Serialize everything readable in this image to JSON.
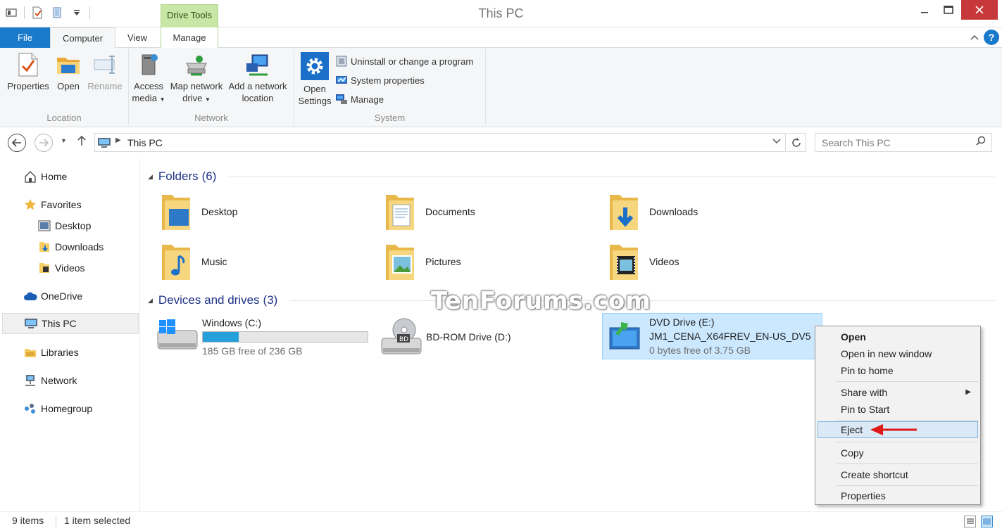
{
  "window": {
    "title": "This PC",
    "context_tab_header": "Drive Tools"
  },
  "tabs": {
    "file": "File",
    "computer": "Computer",
    "view": "View",
    "manage": "Manage"
  },
  "ribbon": {
    "location": {
      "label": "Location",
      "properties": "Properties",
      "open": "Open",
      "rename": "Rename"
    },
    "network": {
      "label": "Network",
      "access_media_1": "Access",
      "access_media_2": "media",
      "map_drive_1": "Map network",
      "map_drive_2": "drive",
      "add_location_1": "Add a network",
      "add_location_2": "location"
    },
    "system": {
      "label": "System",
      "open_settings_1": "Open",
      "open_settings_2": "Settings",
      "uninstall": "Uninstall or change a program",
      "system_properties": "System properties",
      "manage": "Manage"
    }
  },
  "address": {
    "path": "This PC",
    "search_placeholder": "Search This PC"
  },
  "nav": {
    "home": "Home",
    "favorites": "Favorites",
    "desktop": "Desktop",
    "downloads": "Downloads",
    "videos": "Videos",
    "onedrive": "OneDrive",
    "this_pc": "This PC",
    "libraries": "Libraries",
    "network": "Network",
    "homegroup": "Homegroup"
  },
  "folders_group": {
    "title": "Folders",
    "count": "(6)",
    "items": [
      "Desktop",
      "Documents",
      "Downloads",
      "Music",
      "Pictures",
      "Videos"
    ]
  },
  "drives_group": {
    "title": "Devices and drives",
    "count": "(3)",
    "windows": {
      "name": "Windows (C:)",
      "free": "185 GB free of 236 GB",
      "used_fraction": 0.216
    },
    "bdrom": {
      "name": "BD-ROM Drive (D:)"
    },
    "dvd": {
      "name": "DVD Drive (E:)",
      "label": "JM1_CENA_X64FREV_EN-US_DV5",
      "free": "0 bytes free of 3.75 GB"
    }
  },
  "watermark": "TenForums.com",
  "context_menu": {
    "open": "Open",
    "open_new_window": "Open in new window",
    "pin_home": "Pin to home",
    "share_with": "Share with",
    "pin_start": "Pin to Start",
    "eject": "Eject",
    "copy": "Copy",
    "create_shortcut": "Create shortcut",
    "properties": "Properties"
  },
  "status": {
    "items": "9 items",
    "selected": "1 item selected"
  },
  "colors": {
    "accent": "#1979ca",
    "selection": "#cce8ff",
    "context_tab": "#c8e7a6",
    "close": "#c7383a"
  }
}
